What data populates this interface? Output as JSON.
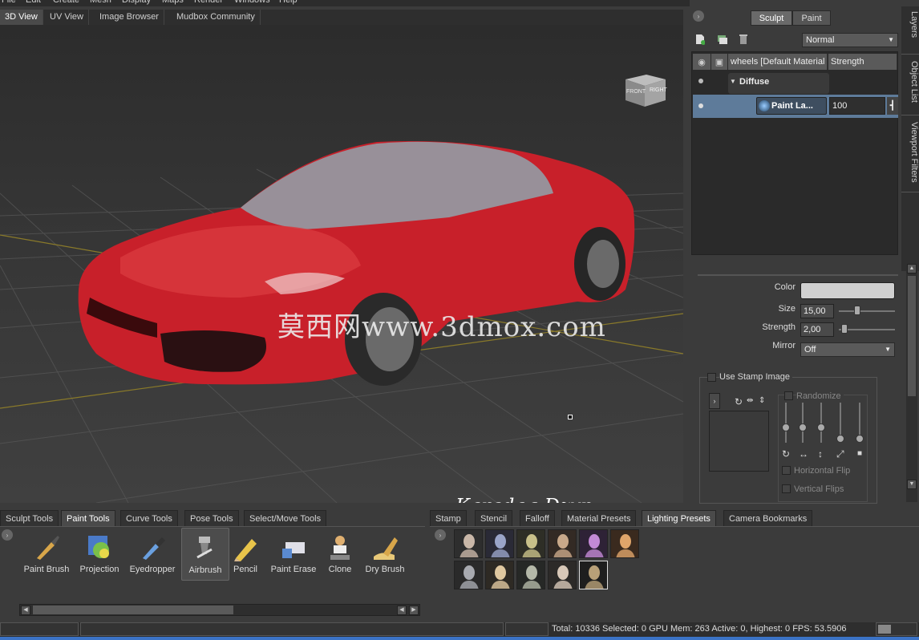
{
  "menu": [
    "File",
    "Edit",
    "Create",
    "Mesh",
    "Display",
    "Maps",
    "Render",
    "Windows",
    "Help"
  ],
  "view_tabs": [
    {
      "label": "3D View",
      "active": true
    },
    {
      "label": "UV View",
      "active": false
    },
    {
      "label": "Image Browser",
      "active": false
    },
    {
      "label": "Mudbox Community",
      "active": false
    }
  ],
  "viewport": {
    "navcube_front": "FRONT",
    "navcube_right": "RIGHT",
    "watermark": "莫西网www.3dmox.com",
    "signature": "Karadag  Dzyn",
    "car_color": "#c8202a"
  },
  "right_panel": {
    "mode_sculpt": "Sculpt",
    "mode_paint": "Paint",
    "blend_mode": "Normal",
    "layer_header_name": "wheels [Default Material",
    "layer_header_strength": "Strength",
    "group_label": "Diffuse",
    "paint_layer_name": "Paint La...",
    "paint_layer_strength": "100",
    "side_tabs": [
      "Layers",
      "Object List",
      "Viewport Filters"
    ]
  },
  "properties": {
    "color_label": "Color",
    "color_value": "#d0d0d0",
    "size_label": "Size",
    "size_value": "15,00",
    "size_level": 0.3,
    "strength_label": "Strength",
    "strength_value": "2,00",
    "strength_level": 0.05,
    "mirror_label": "Mirror",
    "mirror_value": "Off",
    "use_stamp_label": "Use Stamp Image",
    "randomize_label": "Randomize",
    "horizontal_flip_label": "Horizontal Flip",
    "vertical_flip_label": "Vertical Flips"
  },
  "tool_tabs": [
    {
      "label": "Sculpt Tools",
      "active": false
    },
    {
      "label": "Paint Tools",
      "active": true
    },
    {
      "label": "Curve Tools",
      "active": false
    },
    {
      "label": "Pose Tools",
      "active": false
    },
    {
      "label": "Select/Move Tools",
      "active": false
    }
  ],
  "tools": [
    {
      "label": "Paint Brush",
      "icon": "paint-brush-icon",
      "selected": false
    },
    {
      "label": "Projection",
      "icon": "projection-icon",
      "selected": false
    },
    {
      "label": "Eyedropper",
      "icon": "eyedropper-icon",
      "selected": false
    },
    {
      "label": "Airbrush",
      "icon": "airbrush-icon",
      "selected": true
    },
    {
      "label": "Pencil",
      "icon": "pencil-icon",
      "selected": false
    },
    {
      "label": "Paint Erase",
      "icon": "paint-erase-icon",
      "selected": false
    },
    {
      "label": "Clone",
      "icon": "clone-icon",
      "selected": false
    },
    {
      "label": "Dry Brush",
      "icon": "dry-brush-icon",
      "selected": false
    }
  ],
  "preset_tabs": [
    {
      "label": "Stamp",
      "active": false
    },
    {
      "label": "Stencil",
      "active": false
    },
    {
      "label": "Falloff",
      "active": false
    },
    {
      "label": "Material Presets",
      "active": false
    },
    {
      "label": "Lighting Presets",
      "active": true
    },
    {
      "label": "Camera Bookmarks",
      "active": false
    }
  ],
  "lighting_presets": [
    {
      "tint": "#c9b7a8",
      "bg": "#2e2e2e",
      "selected": false
    },
    {
      "tint": "#9aa4c8",
      "bg": "#2a2a36",
      "selected": false
    },
    {
      "tint": "#c8c089",
      "bg": "#2e2e26",
      "selected": false
    },
    {
      "tint": "#c9a98a",
      "bg": "#332a24",
      "selected": false
    },
    {
      "tint": "#c38ad6",
      "bg": "#2e2236",
      "selected": false
    },
    {
      "tint": "#e0a56a",
      "bg": "#3a2a1e",
      "selected": false
    },
    {
      "tint": "#a8aab0",
      "bg": "#2a2a2a",
      "selected": false
    },
    {
      "tint": "#e0c8a0",
      "bg": "#2e2a24",
      "selected": false
    },
    {
      "tint": "#b4b8a8",
      "bg": "#262826",
      "selected": false
    },
    {
      "tint": "#d8c8b8",
      "bg": "#2c2a28",
      "selected": false
    },
    {
      "tint": "#b8a078",
      "bg": "#1e1e1e",
      "selected": true
    }
  ],
  "status": {
    "text": "Total: 10336  Selected: 0 GPU Mem: 263  Active: 0, Highest: 0  FPS: 53.5906"
  }
}
